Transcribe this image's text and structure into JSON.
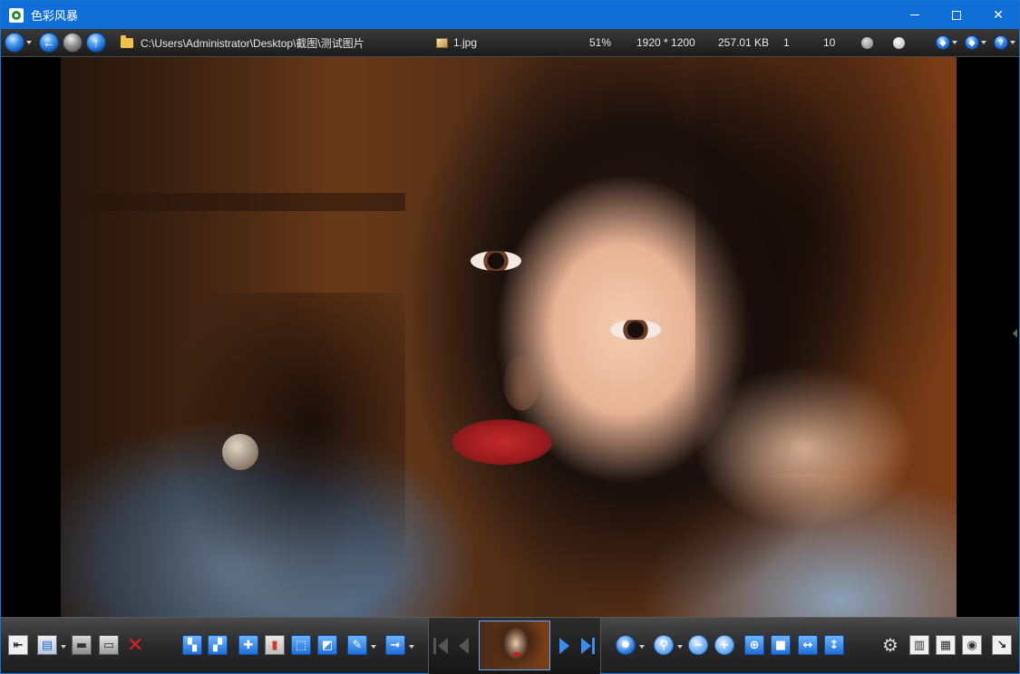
{
  "window": {
    "title": "色彩风暴",
    "minimize_glyph": "",
    "close_glyph": "✕"
  },
  "infobar": {
    "path": "C:\\Users\\Administrator\\Desktop\\截图\\测试图片",
    "filename": "1.jpg",
    "zoom": "51%",
    "dimensions": "1920 * 1200",
    "filesize": "257.01 KB",
    "index": "1",
    "total": "10"
  },
  "icons": {
    "back": "←",
    "up": "↑",
    "export": "→",
    "fit": "⊕"
  },
  "colors": {
    "titlebar": "#0f6fd6",
    "accent_blue": "#1e6fd8",
    "delete_red": "#e01e1e"
  }
}
